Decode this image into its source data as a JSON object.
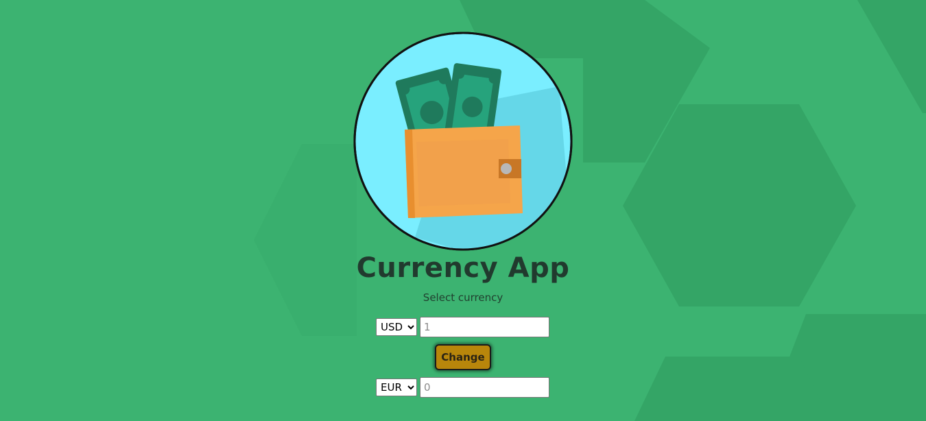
{
  "app": {
    "title": "Currency App",
    "subtitle": "Select currency"
  },
  "logo": {
    "icon": "wallet-with-banknotes-icon",
    "circle_color": "#7aeeff",
    "wallet_color": "#f5a54a",
    "note_color": "#1f7a5c"
  },
  "from": {
    "currency": "USD",
    "options": [
      "USD"
    ],
    "placeholder": "1"
  },
  "to": {
    "currency": "EUR",
    "options": [
      "EUR"
    ],
    "placeholder": "0"
  },
  "actions": {
    "change_label": "Change"
  },
  "theme": {
    "background": "#3cb371",
    "hexagon": "#2e9a5e",
    "button": "#b8860b"
  }
}
